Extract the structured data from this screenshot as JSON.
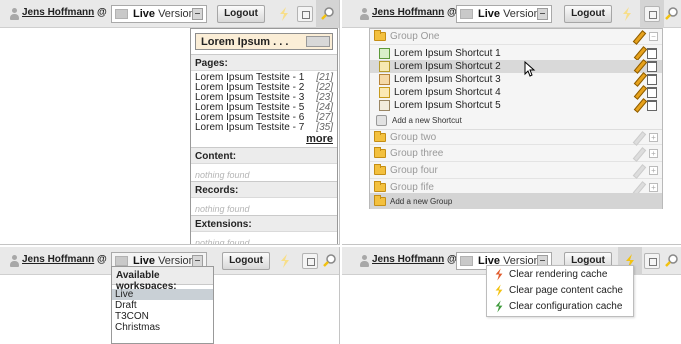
{
  "toolbar": {
    "user_name": "Jens Hoffmann",
    "at_sign": "@",
    "workspace_bold": "Live",
    "workspace_rest": "Version",
    "logout_label": "Logout"
  },
  "colors": {
    "toolbar_bg": "#e9e9e9",
    "highlight": "#fbeed7",
    "folder": "#f3c03e",
    "bolt_red": "#e05a2a",
    "bolt_yellow": "#f2c210",
    "bolt_green": "#3d9a3a"
  },
  "search": {
    "query": "Lorem Ipsum . . .",
    "pages_header": "Pages:",
    "pages": [
      {
        "title": "Lorem Ipsum Testsite - 1",
        "id": "[21]"
      },
      {
        "title": "Lorem Ipsum Testsite - 2",
        "id": "[22]"
      },
      {
        "title": "Lorem Ipsum Testsite - 3",
        "id": "[23]"
      },
      {
        "title": "Lorem Ipsum Testsite - 5",
        "id": "[24]"
      },
      {
        "title": "Lorem Ipsum Testsite - 6",
        "id": "[27]"
      },
      {
        "title": "Lorem Ipsum Testsite - 7",
        "id": "[35]"
      }
    ],
    "more_label": "more",
    "content_header": "Content:",
    "records_header": "Records:",
    "extensions_header": "Extensions:",
    "nothing_found": "nothing found"
  },
  "shortcuts": {
    "groups": [
      "Group One",
      "Group two",
      "Group three",
      "Group four",
      "Group fife"
    ],
    "items": [
      "Lorem Ipsum Shortcut 1",
      "Lorem Ipsum Shortcut 2",
      "Lorem Ipsum Shortcut 3",
      "Lorem Ipsum Shortcut 4",
      "Lorem Ipsum Shortcut 5"
    ],
    "add_shortcut": "Add a new Shortcut",
    "add_group": "Add a new Group"
  },
  "workspaces": {
    "header": "Available workspaces:",
    "items": [
      "Live",
      "Draft",
      "T3CON",
      "Christmas"
    ]
  },
  "cache": {
    "items": [
      "Clear rendering cache",
      "Clear page content cache",
      "Clear configuration cache"
    ]
  }
}
